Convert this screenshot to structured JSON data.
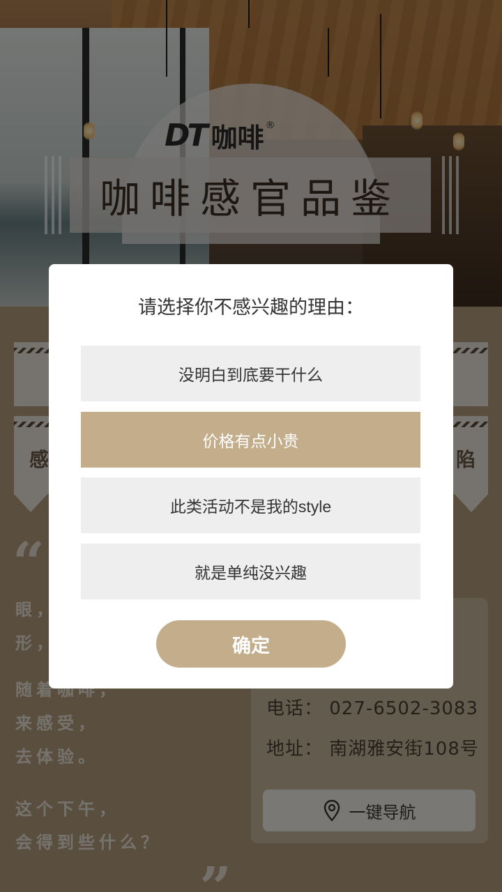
{
  "hero": {
    "logo_mark": "DT",
    "logo_text": "咖啡",
    "logo_registered": "®",
    "title": "咖啡感官品鉴"
  },
  "background": {
    "ribbon_left_word": "感",
    "ribbon_right_word": "陷",
    "quote_open": "“",
    "quote_close": "”",
    "poem": [
      "眼，",
      "形，",
      "随着咖啡，",
      "来感受，",
      "去体验。",
      "这个下午，",
      "会得到些什么？"
    ],
    "info": {
      "phone": "电话：  027-6502-3083",
      "address": "地址：  南湖雅安街108号"
    },
    "nav_button": "一键导航"
  },
  "modal": {
    "title": "请选择你不感兴趣的理由：",
    "options": [
      {
        "label": "没明白到底要干什么",
        "selected": false
      },
      {
        "label": "价格有点小贵",
        "selected": true
      },
      {
        "label": "此类活动不是我的style",
        "selected": false
      },
      {
        "label": "就是单纯没兴趣",
        "selected": false
      }
    ],
    "confirm": "确定"
  },
  "colors": {
    "accent": "#c4ad8a",
    "option_bg": "#eeeeee",
    "page_bg": "#b59e7c"
  }
}
